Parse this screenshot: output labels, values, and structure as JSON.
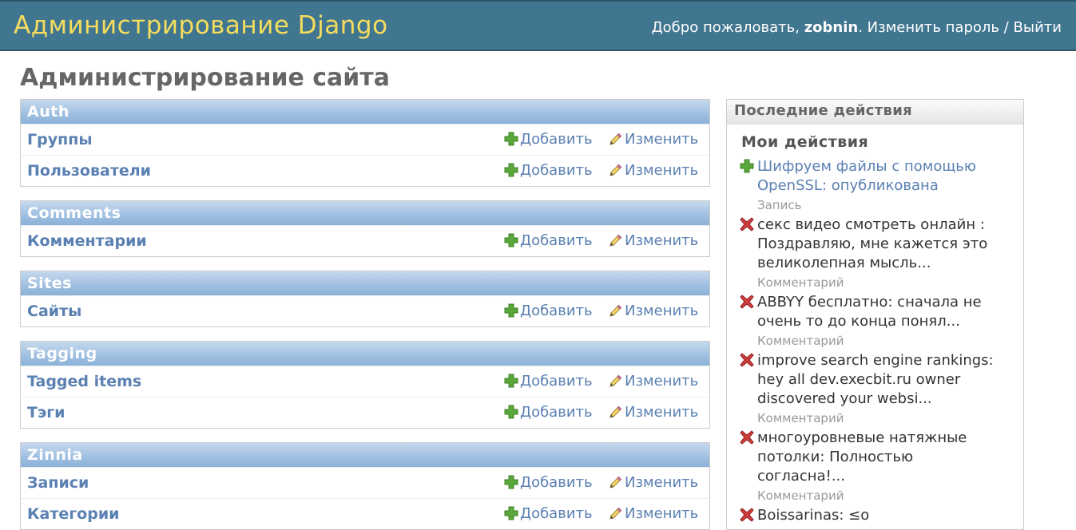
{
  "header": {
    "branding": "Администрирование Django",
    "welcome": "Добро пожаловать,",
    "username": "zobnin",
    "change_password": "Изменить пароль",
    "separator": "/",
    "logout": "Выйти"
  },
  "page_title": "Администрирование сайта",
  "actions": {
    "add_label": "Добавить",
    "change_label": "Изменить",
    "add_icon": "add-plus-icon",
    "change_icon": "pencil-icon"
  },
  "modules": [
    {
      "caption": "Auth",
      "models": [
        {
          "name": "Группы"
        },
        {
          "name": "Пользователи"
        }
      ]
    },
    {
      "caption": "Comments",
      "models": [
        {
          "name": "Комментарии"
        }
      ]
    },
    {
      "caption": "Sites",
      "models": [
        {
          "name": "Сайты"
        }
      ]
    },
    {
      "caption": "Tagging",
      "models": [
        {
          "name": "Tagged items"
        },
        {
          "name": "Тэги"
        }
      ]
    },
    {
      "caption": "Zinnia",
      "models": [
        {
          "name": "Записи"
        },
        {
          "name": "Категории"
        }
      ]
    }
  ],
  "recent": {
    "caption": "Последние действия",
    "heading": "Мои действия",
    "items": [
      {
        "icon": "add-plus-icon",
        "lines": [
          "Шифруем файлы с помощью",
          "OpenSSL: опубликована"
        ],
        "type": "Запись",
        "link": true
      },
      {
        "icon": "delete-x-icon",
        "lines": [
          "секс видео смотреть онлайн :",
          "Поздравляю, мне кажется это",
          "великолепная мысль..."
        ],
        "type": "Комментарий",
        "link": false
      },
      {
        "icon": "delete-x-icon",
        "lines": [
          "ABBYY бесплатно: сначала не",
          "очень то до конца понял..."
        ],
        "type": "Комментарий",
        "link": false
      },
      {
        "icon": "delete-x-icon",
        "lines": [
          "improve search engine rankings:",
          "hey all dev.execbit.ru owner",
          "discovered your websi..."
        ],
        "type": "Комментарий",
        "link": false
      },
      {
        "icon": "delete-x-icon",
        "lines": [
          "многоуровневые натяжные",
          "потолки: Полностью",
          "согласна!..."
        ],
        "type": "Комментарий",
        "link": false
      },
      {
        "icon": "delete-x-icon",
        "lines": [
          "Boissarinas: ≤o"
        ],
        "type": "",
        "link": false
      }
    ]
  },
  "colors": {
    "header_bg": "#417690",
    "branding": "#f5dd5d",
    "link": "#5b80b2",
    "module_caption_bg": "#9fbfe1"
  }
}
